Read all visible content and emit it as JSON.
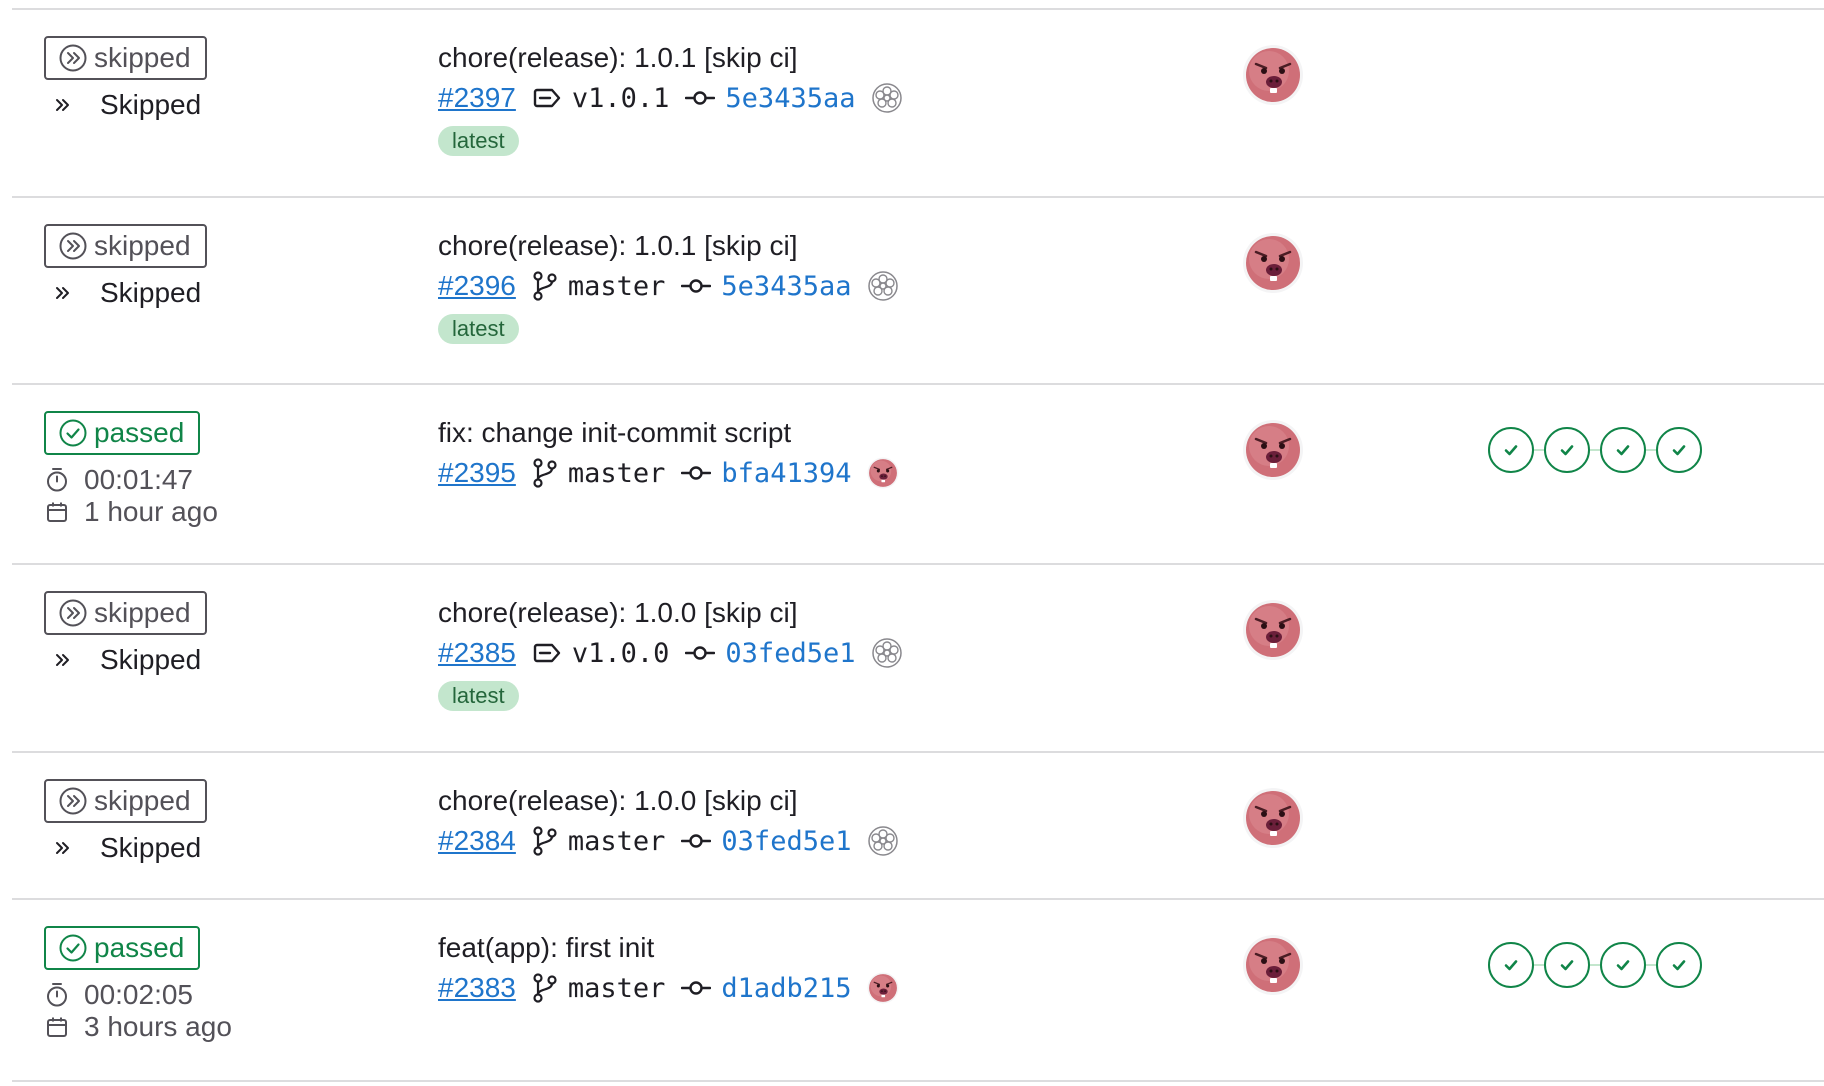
{
  "colors": {
    "success": "#108548",
    "neutral": "#535158",
    "link": "#1f75cb",
    "latest_bg": "#c3e6cd",
    "latest_fg": "#24663b"
  },
  "rows": [
    {
      "status": "skipped",
      "status_label": "skipped",
      "status_icon": "skipped-icon",
      "skipped_text": "Skipped",
      "title": "chore(release): 1.0.1 [skip ci]",
      "pipeline_id": "#2397",
      "ref_type": "tag",
      "ref_icon": "tag-icon",
      "ref": "v1.0.1",
      "sha": "5e3435aa",
      "committer_icon": "system-avatar-icon",
      "latest": "latest",
      "stages": []
    },
    {
      "status": "skipped",
      "status_label": "skipped",
      "status_icon": "skipped-icon",
      "skipped_text": "Skipped",
      "title": "chore(release): 1.0.1 [skip ci]",
      "pipeline_id": "#2396",
      "ref_type": "branch",
      "ref_icon": "branch-icon",
      "ref": "master",
      "sha": "5e3435aa",
      "committer_icon": "system-avatar-icon",
      "latest": "latest",
      "stages": []
    },
    {
      "status": "success",
      "status_label": "passed",
      "status_icon": "status-success-icon",
      "duration": "00:01:47",
      "finished": "1 hour ago",
      "title": "fix: change init-commit script",
      "pipeline_id": "#2395",
      "ref_type": "branch",
      "ref_icon": "branch-icon",
      "ref": "master",
      "sha": "bfa41394",
      "committer_icon": "user-avatar",
      "stages": [
        "passed",
        "passed",
        "passed",
        "passed"
      ]
    },
    {
      "status": "skipped",
      "status_label": "skipped",
      "status_icon": "skipped-icon",
      "skipped_text": "Skipped",
      "title": "chore(release): 1.0.0 [skip ci]",
      "pipeline_id": "#2385",
      "ref_type": "tag",
      "ref_icon": "tag-icon",
      "ref": "v1.0.0",
      "sha": "03fed5e1",
      "committer_icon": "system-avatar-icon",
      "latest": "latest",
      "stages": []
    },
    {
      "status": "skipped",
      "status_label": "skipped",
      "status_icon": "skipped-icon",
      "skipped_text": "Skipped",
      "title": "chore(release): 1.0.0 [skip ci]",
      "pipeline_id": "#2384",
      "ref_type": "branch",
      "ref_icon": "branch-icon",
      "ref": "master",
      "sha": "03fed5e1",
      "committer_icon": "system-avatar-icon",
      "stages": []
    },
    {
      "status": "success",
      "status_label": "passed",
      "status_icon": "status-success-icon",
      "duration": "00:02:05",
      "finished": "3 hours ago",
      "title": "feat(app): first init",
      "pipeline_id": "#2383",
      "ref_type": "branch",
      "ref_icon": "branch-icon",
      "ref": "master",
      "sha": "d1adb215",
      "committer_icon": "user-avatar",
      "stages": [
        "passed",
        "passed",
        "passed",
        "passed"
      ]
    }
  ]
}
